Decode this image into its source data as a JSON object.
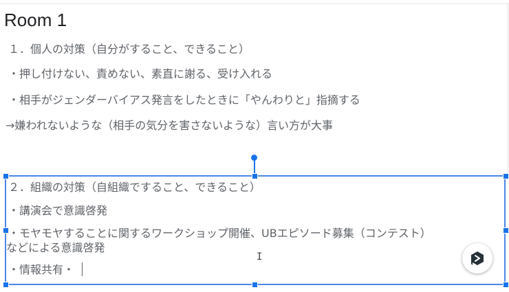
{
  "slide": {
    "title": "Room 1",
    "box1": {
      "heading": "１．個人の対策（自分がすること、できること）",
      "bullet1": "・押し付けない、責めない、素直に謝る、受け入れる",
      "bullet2": "・相手がジェンダーバイアス発言をしたときに「やんわりと」指摘する",
      "note": "→嫌われないような（相手の気分を害さないような）言い方が大事"
    },
    "box2": {
      "heading": "２．組織の対策（自組織ですること、できること）",
      "bullet1": "・講演会で意識啓発",
      "bullet2_line1": "・モヤモヤすることに関するワークショップ開催、UBエピソード募集（コンテスト）",
      "bullet2_line2": "などによる意識啓発",
      "bullet3": "・情報共有・"
    }
  },
  "icons": {
    "fab": "assistant-chat-icon",
    "cursor": "text-cursor-icon"
  },
  "colors": {
    "selection": "#4a86e8",
    "handle": "#1a73e8",
    "text": "#5f6368",
    "title": "#202124"
  }
}
